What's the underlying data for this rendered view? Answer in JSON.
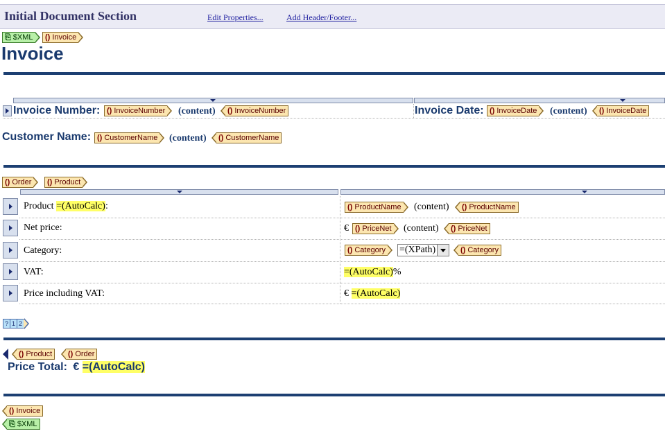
{
  "section": {
    "title": "Initial Document Section",
    "edit_properties": "Edit Properties...",
    "add_header_footer": "Add Header/Footer..."
  },
  "tags": {
    "xml": "$XML",
    "invoice": "Invoice",
    "invoice_number": "InvoiceNumber",
    "invoice_date": "InvoiceDate",
    "customer_name": "CustomerName",
    "order": "Order",
    "product": "Product",
    "product_name": "ProductName",
    "price_net": "PriceNet",
    "category": "Category"
  },
  "heading": "Invoice",
  "fields": {
    "invoice_number_label": "Invoice Number:",
    "invoice_date_label": "Invoice Date:",
    "customer_name_label": "Customer Name:",
    "content": "(content)"
  },
  "table": {
    "rows": [
      {
        "label_prefix": "Product ",
        "label_calc": "=(AutoCalc)",
        "label_suffix": ":"
      },
      {
        "label": "Net price:"
      },
      {
        "label": "Category:"
      },
      {
        "label": "VAT:"
      },
      {
        "label": "Price including VAT:"
      }
    ],
    "currency": "€",
    "autocalc": "=(AutoCalc)",
    "percent": "%",
    "xpath_combo": "=(XPath)"
  },
  "pager": [
    "?",
    "1",
    "2"
  ],
  "total": {
    "label": "Price Total:",
    "currency": "€",
    "value": "=(AutoCalc)"
  }
}
